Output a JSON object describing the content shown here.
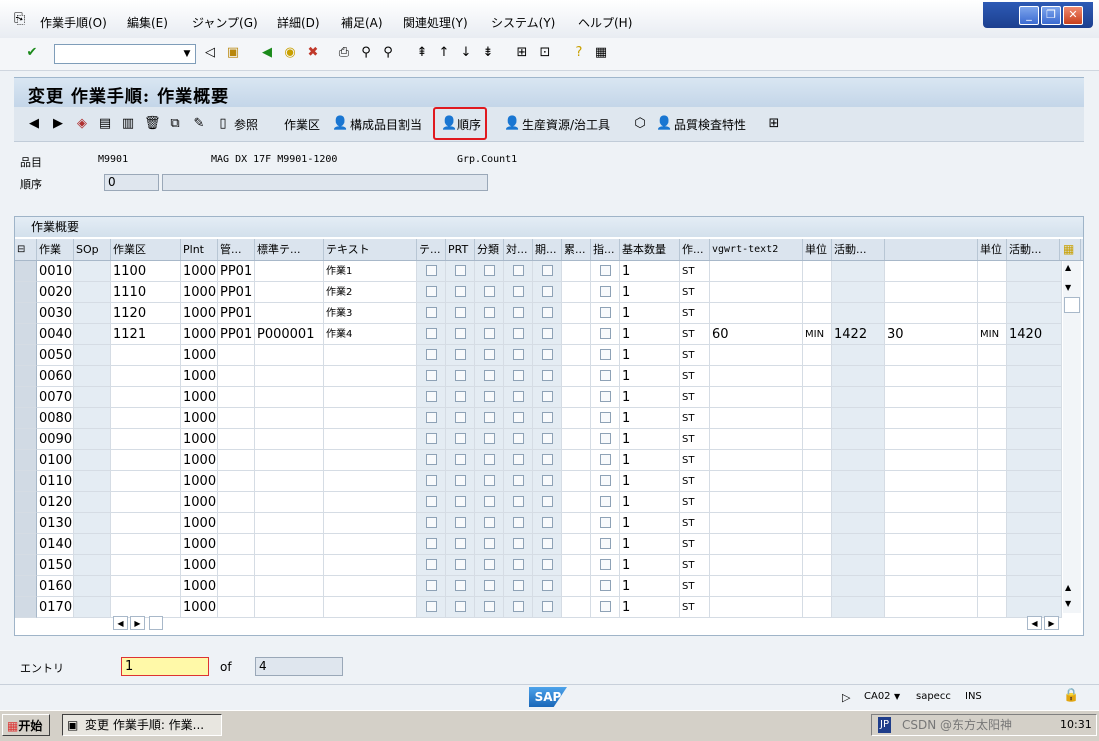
{
  "menu": [
    "作業手順(O)",
    "編集(E)",
    "ジャンプ(G)",
    "詳細(D)",
    "補足(A)",
    "関連処理(Y)",
    "システム(Y)",
    "ヘルプ(H)"
  ],
  "window_controls": {
    "minimize": "_",
    "restore": "❐",
    "close": "✕"
  },
  "title": "変更 作業手順: 作業概要",
  "app_toolbar": {
    "reference": "参照",
    "work_center": "作業区",
    "component_allocation": "構成品目割当",
    "sequence": "順序",
    "prt": "生産資源/治工具",
    "inspection": "品質検査特性"
  },
  "header": {
    "material_label": "品目",
    "material_value": "M9901",
    "material_desc": "MAG DX 17F M9901-1200",
    "group_counter": "Grp.Count1",
    "sequence_label": "順序",
    "sequence_value": "0"
  },
  "table": {
    "title": "作業概要",
    "columns": [
      "作業",
      "SOp",
      "作業区",
      "Plnt",
      "管...",
      "標準テ...",
      "テキスト",
      "テ...",
      "PRT",
      "分類",
      "対...",
      "期...",
      "累...",
      "指...",
      "基本数量",
      "作...",
      "vgwrt-text2",
      "単位",
      "活動...",
      "",
      "単位",
      "活動..."
    ],
    "rows": [
      {
        "op": "0010",
        "wc": "1100",
        "plnt": "1000",
        "ctrl": "PP01",
        "std": "",
        "text": "作業1",
        "qty": "1",
        "unit": "ST",
        "v1": "",
        "u1": "",
        "a1": "",
        "v2": "",
        "u2": "",
        "a2": ""
      },
      {
        "op": "0020",
        "wc": "1110",
        "plnt": "1000",
        "ctrl": "PP01",
        "std": "",
        "text": "作業2",
        "qty": "1",
        "unit": "ST",
        "v1": "",
        "u1": "",
        "a1": "",
        "v2": "",
        "u2": "",
        "a2": ""
      },
      {
        "op": "0030",
        "wc": "1120",
        "plnt": "1000",
        "ctrl": "PP01",
        "std": "",
        "text": "作業3",
        "qty": "1",
        "unit": "ST",
        "v1": "",
        "u1": "",
        "a1": "",
        "v2": "",
        "u2": "",
        "a2": ""
      },
      {
        "op": "0040",
        "wc": "1121",
        "plnt": "1000",
        "ctrl": "PP01",
        "std": "P000001",
        "text": "作業4",
        "qty": "1",
        "unit": "ST",
        "v1": "60",
        "u1": "MIN",
        "a1": "1422",
        "v2": "30",
        "u2": "MIN",
        "a2": "1420"
      },
      {
        "op": "0050",
        "wc": "",
        "plnt": "1000",
        "ctrl": "",
        "std": "",
        "text": "",
        "qty": "1",
        "unit": "ST",
        "v1": "",
        "u1": "",
        "a1": "",
        "v2": "",
        "u2": "",
        "a2": ""
      },
      {
        "op": "0060",
        "wc": "",
        "plnt": "1000",
        "ctrl": "",
        "std": "",
        "text": "",
        "qty": "1",
        "unit": "ST",
        "v1": "",
        "u1": "",
        "a1": "",
        "v2": "",
        "u2": "",
        "a2": ""
      },
      {
        "op": "0070",
        "wc": "",
        "plnt": "1000",
        "ctrl": "",
        "std": "",
        "text": "",
        "qty": "1",
        "unit": "ST",
        "v1": "",
        "u1": "",
        "a1": "",
        "v2": "",
        "u2": "",
        "a2": ""
      },
      {
        "op": "0080",
        "wc": "",
        "plnt": "1000",
        "ctrl": "",
        "std": "",
        "text": "",
        "qty": "1",
        "unit": "ST",
        "v1": "",
        "u1": "",
        "a1": "",
        "v2": "",
        "u2": "",
        "a2": ""
      },
      {
        "op": "0090",
        "wc": "",
        "plnt": "1000",
        "ctrl": "",
        "std": "",
        "text": "",
        "qty": "1",
        "unit": "ST",
        "v1": "",
        "u1": "",
        "a1": "",
        "v2": "",
        "u2": "",
        "a2": ""
      },
      {
        "op": "0100",
        "wc": "",
        "plnt": "1000",
        "ctrl": "",
        "std": "",
        "text": "",
        "qty": "1",
        "unit": "ST",
        "v1": "",
        "u1": "",
        "a1": "",
        "v2": "",
        "u2": "",
        "a2": ""
      },
      {
        "op": "0110",
        "wc": "",
        "plnt": "1000",
        "ctrl": "",
        "std": "",
        "text": "",
        "qty": "1",
        "unit": "ST",
        "v1": "",
        "u1": "",
        "a1": "",
        "v2": "",
        "u2": "",
        "a2": ""
      },
      {
        "op": "0120",
        "wc": "",
        "plnt": "1000",
        "ctrl": "",
        "std": "",
        "text": "",
        "qty": "1",
        "unit": "ST",
        "v1": "",
        "u1": "",
        "a1": "",
        "v2": "",
        "u2": "",
        "a2": ""
      },
      {
        "op": "0130",
        "wc": "",
        "plnt": "1000",
        "ctrl": "",
        "std": "",
        "text": "",
        "qty": "1",
        "unit": "ST",
        "v1": "",
        "u1": "",
        "a1": "",
        "v2": "",
        "u2": "",
        "a2": ""
      },
      {
        "op": "0140",
        "wc": "",
        "plnt": "1000",
        "ctrl": "",
        "std": "",
        "text": "",
        "qty": "1",
        "unit": "ST",
        "v1": "",
        "u1": "",
        "a1": "",
        "v2": "",
        "u2": "",
        "a2": ""
      },
      {
        "op": "0150",
        "wc": "",
        "plnt": "1000",
        "ctrl": "",
        "std": "",
        "text": "",
        "qty": "1",
        "unit": "ST",
        "v1": "",
        "u1": "",
        "a1": "",
        "v2": "",
        "u2": "",
        "a2": ""
      },
      {
        "op": "0160",
        "wc": "",
        "plnt": "1000",
        "ctrl": "",
        "std": "",
        "text": "",
        "qty": "1",
        "unit": "ST",
        "v1": "",
        "u1": "",
        "a1": "",
        "v2": "",
        "u2": "",
        "a2": ""
      },
      {
        "op": "0170",
        "wc": "",
        "plnt": "1000",
        "ctrl": "",
        "std": "",
        "text": "",
        "qty": "1",
        "unit": "ST",
        "v1": "",
        "u1": "",
        "a1": "",
        "v2": "",
        "u2": "",
        "a2": ""
      }
    ]
  },
  "entry": {
    "label": "エントリ",
    "value": "1",
    "of": "of",
    "total": "4"
  },
  "status": {
    "sap": "SAP",
    "transaction": "CA02",
    "server": "sapecc",
    "mode": "INS"
  },
  "taskbar": {
    "start": "开始",
    "window": "変更 作業手順: 作業...",
    "lang": "JP",
    "clock": "10:31",
    "watermark": "CSDN @东方太阳神"
  }
}
